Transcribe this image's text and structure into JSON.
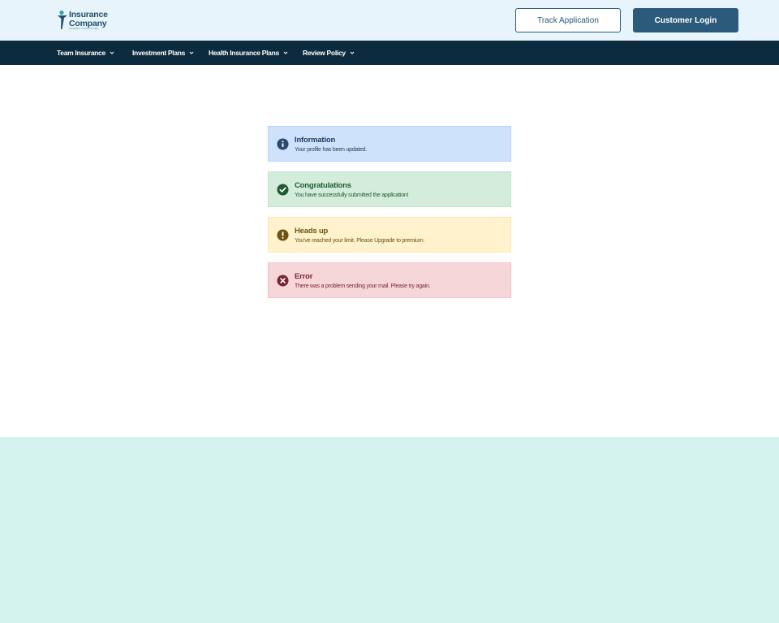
{
  "header": {
    "logo": {
      "line1": "Insurance",
      "line2": "Company",
      "tagline": "SHAPING YOUR FUTURE"
    },
    "track_label": "Track Application",
    "login_label": "Customer Login"
  },
  "nav": {
    "items": [
      {
        "label": "Team Insurance"
      },
      {
        "label": "Investment Plans"
      },
      {
        "label": "Health Insurance Plans"
      },
      {
        "label": "Review Policy"
      }
    ]
  },
  "alerts": [
    {
      "type": "info",
      "title": "Information",
      "message": "Your profile has been updated.",
      "bg": "#cfe2fc",
      "border": "#b6d4fb",
      "color": "#1d3f66",
      "icon": "info-icon"
    },
    {
      "type": "success",
      "title": "Congratulations",
      "message": "You have successfully submitted the application!",
      "bg": "#d4ecdb",
      "border": "#c1e2ca",
      "color": "#1f5a31",
      "icon": "check-circle-icon"
    },
    {
      "type": "warning",
      "title": "Heads up",
      "message": "You've reached your limit. Please Upgrade to premium.",
      "bg": "#fff2cc",
      "border": "#ffe9b0",
      "color": "#6b5312",
      "icon": "exclamation-circle-icon"
    },
    {
      "type": "error",
      "title": "Error",
      "message": "There was a problem sending your mail. Please try again.",
      "bg": "#f7d6da",
      "border": "#f2c3c9",
      "color": "#7a2431",
      "icon": "x-circle-icon"
    }
  ],
  "colors": {
    "topbar_bg": "#e8f4fc",
    "nav_bg": "#0d2b3e",
    "primary": "#2b5a7a",
    "footer_bg": "#d4f3ee"
  }
}
